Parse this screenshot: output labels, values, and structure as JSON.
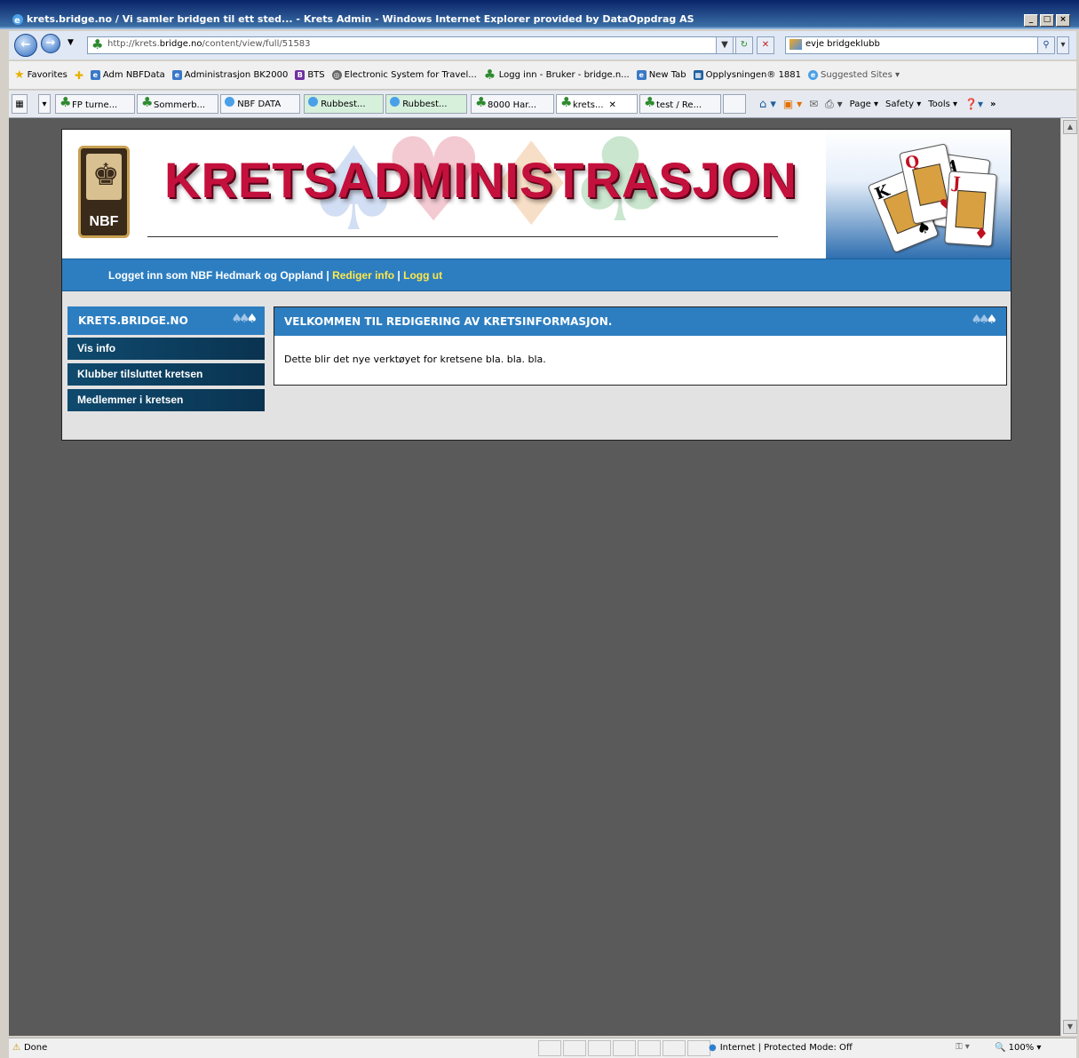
{
  "window": {
    "title": "krets.bridge.no / Vi samler bridgen til ett sted... - Krets Admin - Windows Internet Explorer provided by DataOppdrag AS"
  },
  "address_bar": {
    "url_prefix": "http://krets.",
    "url_domain": "bridge.no",
    "url_path": "/content/view/full/51583",
    "search_value": "evje bridgeklubb"
  },
  "favorites_bar": {
    "label": "Favorites",
    "items": [
      "Adm NBFData",
      "Administrasjon BK2000",
      "BTS",
      "Electronic System for Travel...",
      "Logg inn - Bruker - bridge.n...",
      "New Tab",
      "Opplysningen® 1881",
      "Suggested Sites ▾"
    ]
  },
  "tabs": [
    "FP turne...",
    "Sommerb...",
    "NBF DATA",
    "Rubbest...",
    "Rubbest...",
    "8000 Har...",
    "krets...",
    "test / Re..."
  ],
  "command_bar": {
    "page": "Page ▾",
    "safety": "Safety ▾",
    "tools": "Tools ▾"
  },
  "site": {
    "banner_title": "KRETSADMINISTRASJON",
    "logo_text": "NBF",
    "nav": {
      "logged_in_text": "Logget inn som NBF Hedmark og Oppland",
      "separator": "|",
      "edit_info": "Rediger info",
      "logout": "Logg ut"
    },
    "sidebar": {
      "heading": "KRETS.BRIDGE.NO",
      "items": [
        "Vis info",
        "Klubber tilsluttet kretsen",
        "Medlemmer i kretsen"
      ]
    },
    "main": {
      "heading": "VELKOMMEN TIL REDIGERING AV KRETSINFORMASJON.",
      "body": "Dette blir det nye verktøyet for kretsene bla. bla. bla."
    }
  },
  "status_bar": {
    "text": "Done",
    "zone": "Internet | Protected Mode: Off",
    "zoom": "100%"
  }
}
